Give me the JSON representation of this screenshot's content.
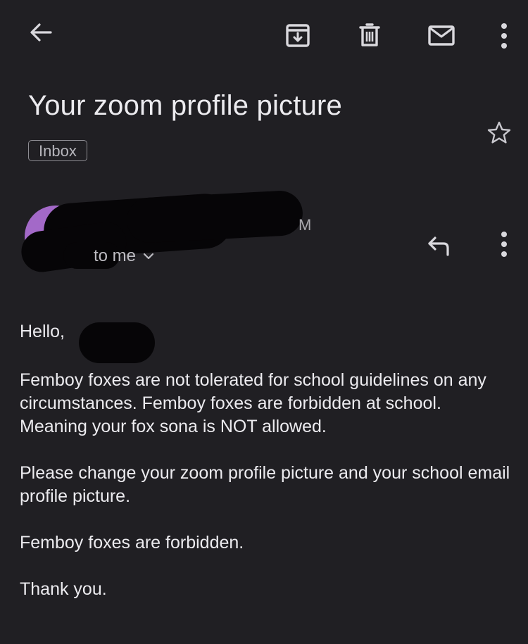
{
  "toolbar": {
    "back_icon": "arrow-left-icon",
    "archive_icon": "archive-icon",
    "delete_icon": "trash-icon",
    "mark_unread_icon": "mail-icon",
    "more_icon": "more-vert-icon"
  },
  "email": {
    "subject": "Your zoom profile picture",
    "label": "Inbox",
    "starred": false,
    "sender": {
      "name_visible_suffix": "M",
      "avatar_color": "#a369c8"
    },
    "recipient": "to me",
    "greeting": "Hello,",
    "paragraphs": [
      "Femboy foxes are not tolerated for school guidelines on any circumstances. Femboy foxes are forbidden at school. Meaning your fox sona is NOT allowed.",
      "Please change your zoom profile picture and your school email profile picture.",
      "Femboy foxes are forbidden.",
      "Thank you."
    ]
  },
  "colors": {
    "background": "#201f23",
    "text": "#ecebef",
    "muted": "#a9a8ae"
  }
}
